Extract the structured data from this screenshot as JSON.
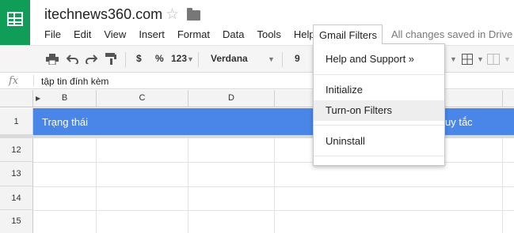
{
  "header": {
    "doc_title": "itechnews360.com",
    "star_icon": "star-icon",
    "folder_icon": "folder-icon",
    "saved_status": "All changes saved in Drive"
  },
  "menu": {
    "items": [
      "File",
      "Edit",
      "View",
      "Insert",
      "Format",
      "Data",
      "Tools",
      "Help"
    ],
    "active_menu": "Gmail Filters"
  },
  "toolbar": {
    "currency": "$",
    "percent": "%",
    "number_format": "123",
    "font": "Verdana",
    "font_size": "9"
  },
  "formula_bar": {
    "icon": "fx",
    "value": "tập tin đính kèm"
  },
  "sheet": {
    "columns": [
      "B",
      "C",
      "D"
    ],
    "rows": [
      "1",
      "12",
      "13",
      "14",
      "15"
    ],
    "header_cells": [
      "Trạng thái",
      "uy tắc"
    ],
    "header_color": "#4a86e8"
  },
  "dropdown": {
    "items": [
      "Help and Support »",
      "Initialize",
      "Turn-on Filters",
      "Uninstall"
    ],
    "highlighted": "Turn-on Filters"
  },
  "colors": {
    "brand": "#0f9d58",
    "header_row": "#4a86e8"
  }
}
